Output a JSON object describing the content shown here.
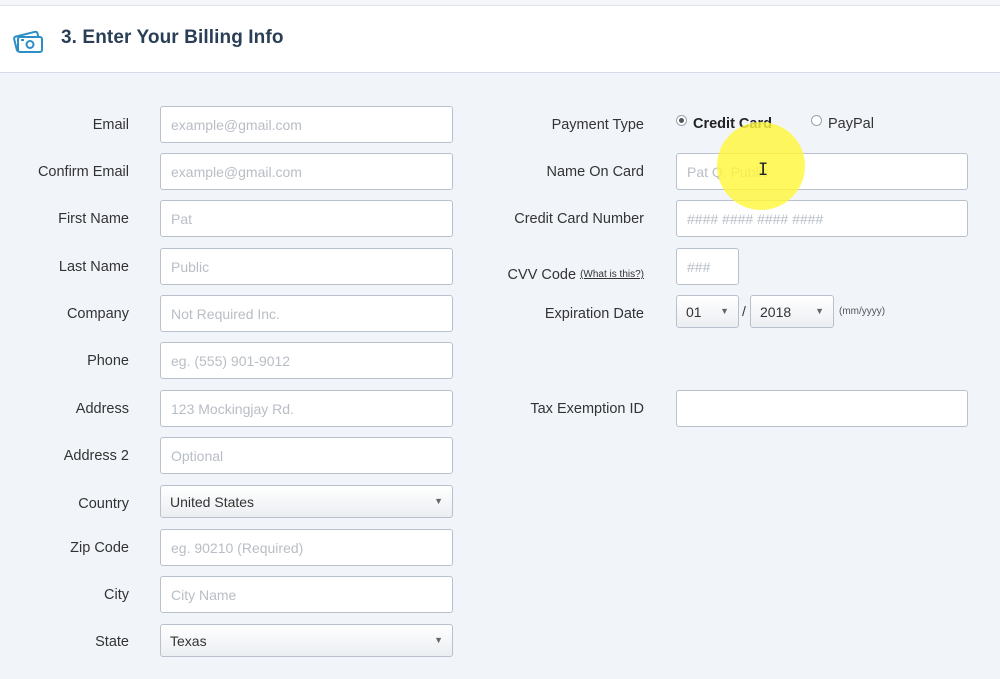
{
  "section": {
    "title": "3. Enter Your Billing Info",
    "icon": "cash-card-icon"
  },
  "left_fields": [
    {
      "label": "Email",
      "placeholder": "example@gmail.com"
    },
    {
      "label": "Confirm Email",
      "placeholder": "example@gmail.com"
    },
    {
      "label": "First Name",
      "placeholder": "Pat"
    },
    {
      "label": "Last Name",
      "placeholder": "Public"
    },
    {
      "label": "Company",
      "placeholder": "Not Required Inc."
    },
    {
      "label": "Phone",
      "placeholder": "eg. (555) 901-9012"
    },
    {
      "label": "Address",
      "placeholder": "123 Mockingjay Rd."
    },
    {
      "label": "Address 2",
      "placeholder": "Optional"
    },
    {
      "label": "Country",
      "value": "United States"
    },
    {
      "label": "Zip Code",
      "placeholder": "eg. 90210 (Required)"
    },
    {
      "label": "City",
      "placeholder": "City Name"
    },
    {
      "label": "State",
      "value": "Texas"
    }
  ],
  "payment": {
    "label": "Payment Type",
    "options": [
      {
        "label": "Credit Card",
        "selected": true
      },
      {
        "label": "PayPal",
        "selected": false
      }
    ]
  },
  "name_on_card": {
    "label": "Name On Card",
    "placeholder": "Pat Q. Public"
  },
  "card_number": {
    "label": "Credit Card Number",
    "placeholder": "#### #### #### ####"
  },
  "cvv": {
    "label": "CVV Code",
    "help_link": "(What is this?)",
    "placeholder": "###"
  },
  "expiration": {
    "label": "Expiration Date",
    "month": "01",
    "separator": "/",
    "year": "2018",
    "hint": "(mm/yyyy)"
  },
  "tax": {
    "label": "Tax Exemption ID",
    "value": ""
  },
  "colors": {
    "panel_bg": "#f1f5fa",
    "title": "#2a3f55",
    "highlight": "#fff63c"
  }
}
